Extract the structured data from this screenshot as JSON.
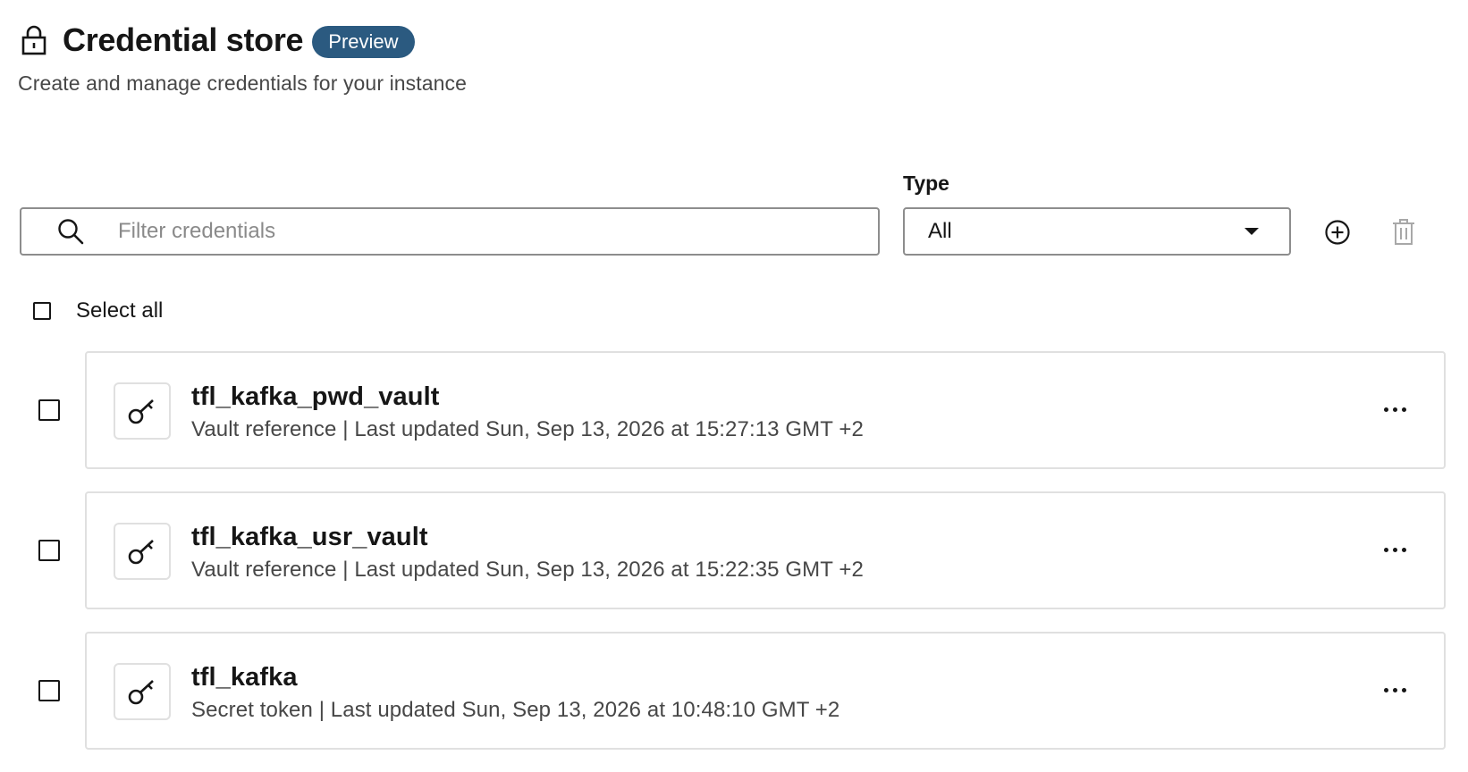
{
  "header": {
    "title": "Credential store",
    "badge": "Preview",
    "subtitle": "Create and manage credentials for your instance",
    "icon": "lock-icon"
  },
  "filters": {
    "search_placeholder": "Filter credentials",
    "search_value": "",
    "type_label": "Type",
    "type_value": "All",
    "add_icon": "add-circle-icon",
    "delete_icon": "trash-icon"
  },
  "select_all": {
    "label": "Select all",
    "checked": false
  },
  "credentials": [
    {
      "name": "tfl_kafka_pwd_vault",
      "meta": "Vault reference | Last updated Sun, Sep 13, 2026 at 15:27:13 GMT +2",
      "icon": "key-icon",
      "checked": false
    },
    {
      "name": "tfl_kafka_usr_vault",
      "meta": "Vault reference | Last updated Sun, Sep 13, 2026 at 15:22:35 GMT +2",
      "icon": "key-icon",
      "checked": false
    },
    {
      "name": "tfl_kafka",
      "meta": "Secret token | Last updated Sun, Sep 13, 2026 at 10:48:10 GMT +2",
      "icon": "key-icon",
      "checked": false
    }
  ],
  "colors": {
    "badge_bg": "#2b5a80",
    "border": "#8d8d8d",
    "card_border": "#e0e0e0",
    "text_primary": "#161616",
    "text_secondary": "#474747"
  }
}
